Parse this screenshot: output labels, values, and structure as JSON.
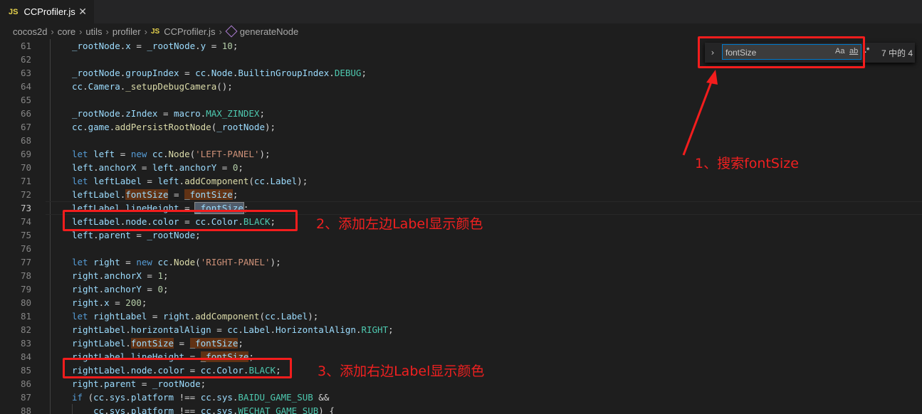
{
  "tab": {
    "badge": "JS",
    "title": "CCProfiler.js",
    "close": "✕"
  },
  "breadcrumb": {
    "items": [
      "cocos2d",
      "core",
      "utils",
      "profiler"
    ],
    "file_badge": "JS",
    "file": "CCProfiler.js",
    "symbol": "generateNode",
    "separator": "›"
  },
  "find": {
    "toggle": "›",
    "value": "fontSize",
    "opt_case": "Aa",
    "opt_word": "ab",
    "opt_regex": ".*",
    "count": "7 中的 4"
  },
  "code_lines": [
    {
      "n": "61",
      "t": "_rootNode.x = _rootNode.y = 10;"
    },
    {
      "n": "62",
      "t": ""
    },
    {
      "n": "63",
      "t": "_rootNode.groupIndex = cc.Node.BuiltinGroupIndex.DEBUG;"
    },
    {
      "n": "64",
      "t": "cc.Camera._setupDebugCamera();"
    },
    {
      "n": "65",
      "t": ""
    },
    {
      "n": "66",
      "t": "_rootNode.zIndex = macro.MAX_ZINDEX;"
    },
    {
      "n": "67",
      "t": "cc.game.addPersistRootNode(_rootNode);"
    },
    {
      "n": "68",
      "t": ""
    },
    {
      "n": "69",
      "t": "let left = new cc.Node('LEFT-PANEL');"
    },
    {
      "n": "70",
      "t": "left.anchorX = left.anchorY = 0;"
    },
    {
      "n": "71",
      "t": "let leftLabel = left.addComponent(cc.Label);"
    },
    {
      "n": "72",
      "t": "leftLabel.fontSize = _fontSize;"
    },
    {
      "n": "73",
      "t": "leftLabel.lineHeight = _fontSize;"
    },
    {
      "n": "74",
      "t": "leftLabel.node.color = cc.Color.BLACK;"
    },
    {
      "n": "75",
      "t": "left.parent = _rootNode;"
    },
    {
      "n": "76",
      "t": ""
    },
    {
      "n": "77",
      "t": "let right = new cc.Node('RIGHT-PANEL');"
    },
    {
      "n": "78",
      "t": "right.anchorX = 1;"
    },
    {
      "n": "79",
      "t": "right.anchorY = 0;"
    },
    {
      "n": "80",
      "t": "right.x = 200;"
    },
    {
      "n": "81",
      "t": "let rightLabel = right.addComponent(cc.Label);"
    },
    {
      "n": "82",
      "t": "rightLabel.horizontalAlign = cc.Label.HorizontalAlign.RIGHT;"
    },
    {
      "n": "83",
      "t": "rightLabel.fontSize = _fontSize;"
    },
    {
      "n": "84",
      "t": "rightLabel.lineHeight = _fontSize;"
    },
    {
      "n": "85",
      "t": "rightLabel.node.color = cc.Color.BLACK;"
    },
    {
      "n": "86",
      "t": "right.parent = _rootNode;"
    },
    {
      "n": "87",
      "t": "if (cc.sys.platform !== cc.sys.BAIDU_GAME_SUB &&"
    },
    {
      "n": "88",
      "t": "    cc.sys.platform !== cc.sys.WECHAT_GAME_SUB) {"
    }
  ],
  "annotations": {
    "a1": "1、搜索fontSize",
    "a2": "2、添加左边Label显示颜色",
    "a3": "3、添加右边Label显示颜色"
  },
  "colors": {
    "annotation": "#f31d1d",
    "editor_bg": "#1e1e1e",
    "find_border": "#007acc"
  },
  "active_line": "73"
}
